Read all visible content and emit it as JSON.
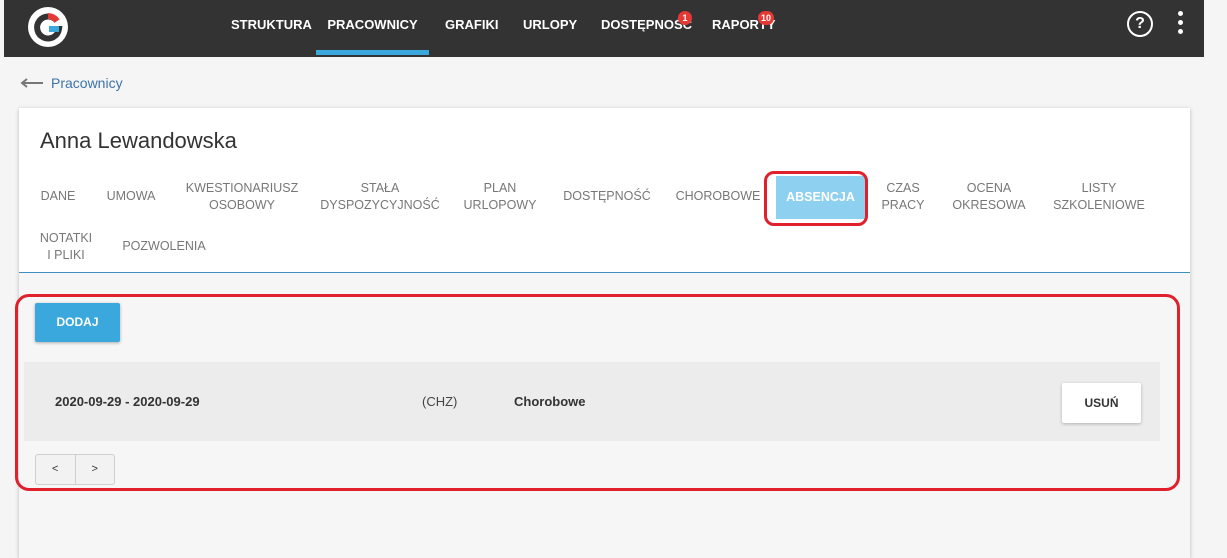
{
  "topbar": {
    "nav": [
      {
        "label": "Struktura",
        "badge": ""
      },
      {
        "label": "Pracownicy",
        "badge": ""
      },
      {
        "label": "Grafiki",
        "badge": ""
      },
      {
        "label": "Urlopy",
        "badge": ""
      },
      {
        "label": "Dostępność",
        "badge": "1"
      },
      {
        "label": "Raporty",
        "badge": "10"
      }
    ],
    "active_nav": "Pracownicy",
    "help_label": "?"
  },
  "breadcrumb": {
    "back_label": "Pracownicy"
  },
  "employee": {
    "name": "Anna Lewandowska"
  },
  "tabs": [
    {
      "line1": "Dane",
      "line2": ""
    },
    {
      "line1": "Umowa",
      "line2": ""
    },
    {
      "line1": "Kwestionariusz",
      "line2": "osobowy"
    },
    {
      "line1": "Stała",
      "line2": "dyspozycyjność"
    },
    {
      "line1": "Plan",
      "line2": "urlopowy"
    },
    {
      "line1": "Dostępność",
      "line2": ""
    },
    {
      "line1": "Chorobowe",
      "line2": ""
    },
    {
      "line1": "Absencja",
      "line2": ""
    },
    {
      "line1": "Czas",
      "line2": "pracy"
    },
    {
      "line1": "Ocena",
      "line2": "okresowa"
    },
    {
      "line1": "Listy",
      "line2": "szkoleniowe"
    },
    {
      "line1": "Notatki",
      "line2": "i pliki"
    },
    {
      "line1": "Pozwolenia",
      "line2": ""
    }
  ],
  "active_tab": "Absencja",
  "absences": {
    "add_label": "Dodaj",
    "rows": [
      {
        "dates": "2020-09-29 - 2020-09-29",
        "code": "(CHZ)",
        "type": "Chorobowe",
        "delete_label": "Usuń"
      }
    ],
    "pager": {
      "prev": "<",
      "next": ">"
    }
  },
  "colors": {
    "topbar": "#333333",
    "accent": "#3aa8dc",
    "active_tab_bg": "#8ed0f0",
    "highlight": "#e0202a",
    "badge": "#e53935"
  }
}
